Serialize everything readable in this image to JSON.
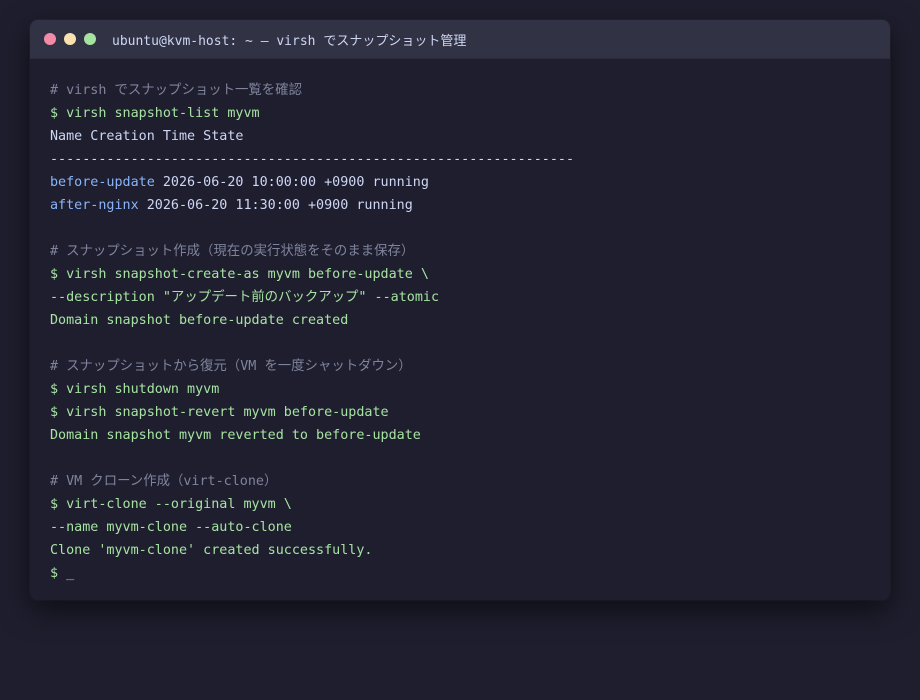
{
  "window": {
    "title": "ubuntu@kvm-host: ~ — virsh でスナップショット管理"
  },
  "terminal": {
    "lines": [
      {
        "type": "comment",
        "text": "# virsh でスナップショット一覧を確認"
      },
      {
        "type": "cmd",
        "text": "$ virsh snapshot-list myvm"
      },
      {
        "type": "out",
        "text": "Name Creation Time State"
      },
      {
        "type": "rule",
        "text": "-----------------------------------------------------------------"
      },
      {
        "type": "snap",
        "name": "before-update",
        "rest": " 2026-06-20 10:00:00 +0900 running"
      },
      {
        "type": "snap",
        "name": "after-nginx",
        "rest": " 2026-06-20 11:30:00 +0900 running"
      },
      {
        "type": "blank",
        "text": ""
      },
      {
        "type": "comment",
        "text": "# スナップショット作成（現在の実行状態をそのまま保存）"
      },
      {
        "type": "cmd",
        "text": "$ virsh snapshot-create-as myvm before-update \\"
      },
      {
        "type": "cmd",
        "text": "--description \"アップデート前のバックアップ\" --atomic"
      },
      {
        "type": "ok",
        "text": "Domain snapshot before-update created"
      },
      {
        "type": "blank",
        "text": ""
      },
      {
        "type": "comment",
        "text": "# スナップショットから復元（VM を一度シャットダウン）"
      },
      {
        "type": "cmd",
        "text": "$ virsh shutdown myvm"
      },
      {
        "type": "cmd",
        "text": "$ virsh snapshot-revert myvm before-update"
      },
      {
        "type": "ok",
        "text": "Domain snapshot myvm reverted to before-update"
      },
      {
        "type": "blank",
        "text": ""
      },
      {
        "type": "comment",
        "text": "# VM クローン作成（virt-clone）"
      },
      {
        "type": "cmd",
        "text": "$ virt-clone --original myvm \\"
      },
      {
        "type": "cmd",
        "text": "--name myvm-clone --auto-clone"
      },
      {
        "type": "ok",
        "text": "Clone 'myvm-clone' created successfully."
      },
      {
        "type": "cmd",
        "text": "$ _"
      }
    ]
  },
  "colors": {
    "background": "#1e1e2e",
    "titlebar": "#313244",
    "comment": "#7f849c",
    "command": "#a6e3a1",
    "output": "#cdd6f4",
    "snapshot_name": "#89b4fa",
    "close": "#f38ba8",
    "minimize": "#f9e2af",
    "maximize": "#a6e3a1"
  },
  "icons": {
    "close": "close-dot-icon",
    "minimize": "minimize-dot-icon",
    "maximize": "maximize-dot-icon"
  }
}
